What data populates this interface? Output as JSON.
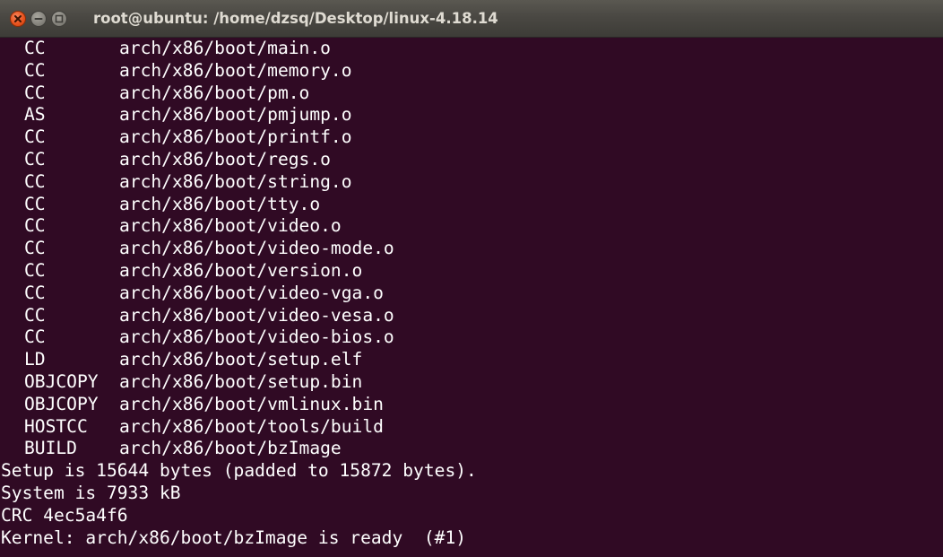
{
  "window": {
    "title": "root@ubuntu: /home/dzsq/Desktop/linux-4.18.14"
  },
  "colors": {
    "background": "#300a24",
    "text": "#ffffff",
    "titlebar": "#4a4843",
    "title_text": "#dfdbd2",
    "close_button": "#e9541f"
  },
  "terminal": {
    "build_lines": [
      {
        "cmd": "CC",
        "path": "arch/x86/boot/main.o"
      },
      {
        "cmd": "CC",
        "path": "arch/x86/boot/memory.o"
      },
      {
        "cmd": "CC",
        "path": "arch/x86/boot/pm.o"
      },
      {
        "cmd": "AS",
        "path": "arch/x86/boot/pmjump.o"
      },
      {
        "cmd": "CC",
        "path": "arch/x86/boot/printf.o"
      },
      {
        "cmd": "CC",
        "path": "arch/x86/boot/regs.o"
      },
      {
        "cmd": "CC",
        "path": "arch/x86/boot/string.o"
      },
      {
        "cmd": "CC",
        "path": "arch/x86/boot/tty.o"
      },
      {
        "cmd": "CC",
        "path": "arch/x86/boot/video.o"
      },
      {
        "cmd": "CC",
        "path": "arch/x86/boot/video-mode.o"
      },
      {
        "cmd": "CC",
        "path": "arch/x86/boot/version.o"
      },
      {
        "cmd": "CC",
        "path": "arch/x86/boot/video-vga.o"
      },
      {
        "cmd": "CC",
        "path": "arch/x86/boot/video-vesa.o"
      },
      {
        "cmd": "CC",
        "path": "arch/x86/boot/video-bios.o"
      },
      {
        "cmd": "LD",
        "path": "arch/x86/boot/setup.elf"
      },
      {
        "cmd": "OBJCOPY",
        "path": "arch/x86/boot/setup.bin"
      },
      {
        "cmd": "OBJCOPY",
        "path": "arch/x86/boot/vmlinux.bin"
      },
      {
        "cmd": "HOSTCC",
        "path": "arch/x86/boot/tools/build"
      },
      {
        "cmd": "BUILD",
        "path": "arch/x86/boot/bzImage"
      }
    ],
    "summary_lines": [
      "Setup is 15644 bytes (padded to 15872 bytes).",
      "System is 7933 kB",
      "CRC 4ec5a4f6",
      "Kernel: arch/x86/boot/bzImage is ready  (#1)"
    ]
  }
}
